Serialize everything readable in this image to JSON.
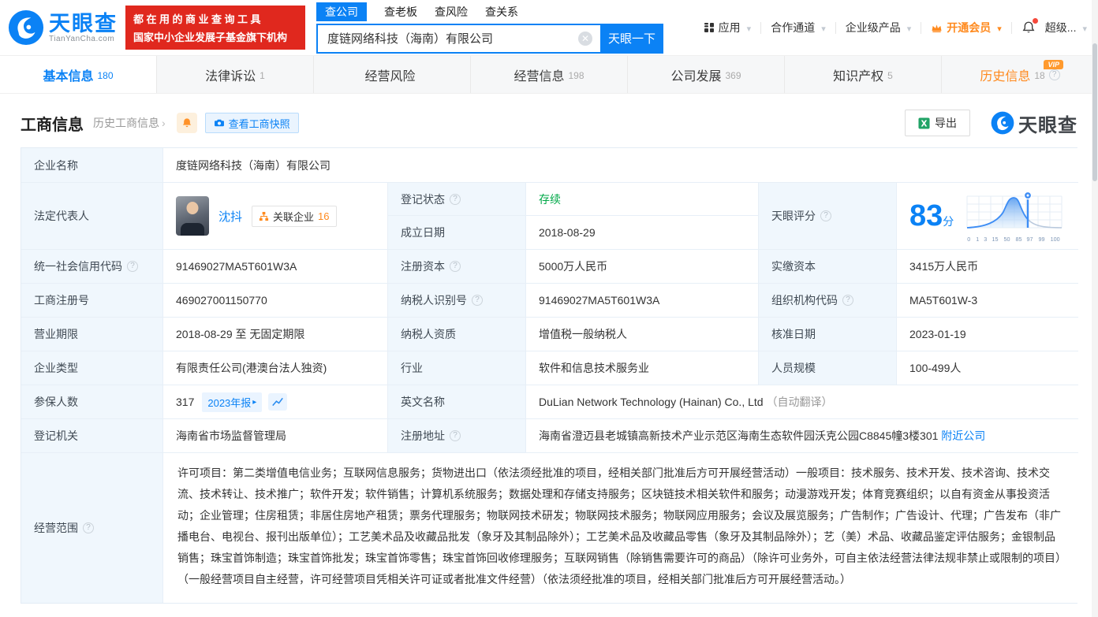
{
  "brand": {
    "logo_text": "天眼查",
    "domain": "TianYanCha.com",
    "slogan1": "都在用的商业查询工具",
    "slogan2": "国家中小企业发展子基金旗下机构"
  },
  "search": {
    "tabs": [
      "查公司",
      "查老板",
      "查风险",
      "查关系"
    ],
    "value": "度链网络科技（海南）有限公司",
    "button": "天眼一下"
  },
  "nav": {
    "app": "应用",
    "partner": "合作通道",
    "enterprise": "企业级产品",
    "vip": "开通会员",
    "super": "超级..."
  },
  "tabs": [
    {
      "label": "基本信息",
      "count": "180"
    },
    {
      "label": "法律诉讼",
      "count": "1"
    },
    {
      "label": "经营风险",
      "count": ""
    },
    {
      "label": "经营信息",
      "count": "198"
    },
    {
      "label": "公司发展",
      "count": "369"
    },
    {
      "label": "知识产权",
      "count": "5"
    },
    {
      "label": "历史信息",
      "count": "18",
      "vip_badge": "VIP"
    }
  ],
  "section": {
    "title": "工商信息",
    "history": "历史工商信息",
    "snapshot": "查看工商快照",
    "export": "导出",
    "brand": "天眼查"
  },
  "table": {
    "company_name_label": "企业名称",
    "company_name": "度链网络科技（海南）有限公司",
    "legal_rep_label": "法定代表人",
    "legal_rep_name": "沈抖",
    "related_company_label": "关联企业",
    "related_company_count": "16",
    "reg_status_label": "登记状态",
    "reg_status": "存续",
    "established_label": "成立日期",
    "established": "2018-08-29",
    "score_label": "天眼评分",
    "score_value": "83",
    "score_unit": "分",
    "score_ticks": [
      "0",
      "1",
      "3",
      "15",
      "50",
      "85",
      "97",
      "99",
      "100"
    ],
    "credit_code_label": "统一社会信用代码",
    "credit_code": "91469027MA5T601W3A",
    "reg_capital_label": "注册资本",
    "reg_capital": "5000万人民币",
    "paid_capital_label": "实缴资本",
    "paid_capital": "3415万人民币",
    "reg_no_label": "工商注册号",
    "reg_no": "469027001150770",
    "taxpayer_no_label": "纳税人识别号",
    "taxpayer_no": "91469027MA5T601W3A",
    "org_code_label": "组织机构代码",
    "org_code": "MA5T601W-3",
    "term_label": "营业期限",
    "term": "2018-08-29 至 无固定期限",
    "taxpayer_type_label": "纳税人资质",
    "taxpayer_type": "增值税一般纳税人",
    "approve_date_label": "核准日期",
    "approve_date": "2023-01-19",
    "type_label": "企业类型",
    "type": "有限责任公司(港澳台法人独资)",
    "industry_label": "行业",
    "industry": "软件和信息技术服务业",
    "staff_label": "人员规模",
    "staff": "100-499人",
    "insured_label": "参保人数",
    "insured": "317",
    "annual_report": "2023年报",
    "en_name_label": "英文名称",
    "en_name": "DuLian Network Technology (Hainan) Co., Ltd",
    "en_note": "（自动翻译）",
    "authority_label": "登记机关",
    "authority": "海南省市场监督管理局",
    "address_label": "注册地址",
    "address": "海南省澄迈县老城镇高新技术产业示范区海南生态软件园沃克公园C8845幢3楼301",
    "nearby": "附近公司",
    "scope_label": "经营范围",
    "scope": "许可项目：第二类增值电信业务；互联网信息服务；货物进出口（依法须经批准的项目，经相关部门批准后方可开展经营活动）一般项目：技术服务、技术开发、技术咨询、技术交流、技术转让、技术推广；软件开发；软件销售；计算机系统服务；数据处理和存储支持服务；区块链技术相关软件和服务；动漫游戏开发；体育竞赛组织；以自有资金从事投资活动；企业管理；住房租赁；非居住房地产租赁；票务代理服务；物联网技术研发；物联网技术服务；物联网应用服务；会议及展览服务；广告制作；广告设计、代理；广告发布（非广播电台、电视台、报刊出版单位）；工艺美术品及收藏品批发（象牙及其制品除外）；工艺美术品及收藏品零售（象牙及其制品除外）；艺（美）术品、收藏品鉴定评估服务；金银制品销售；珠宝首饰制造；珠宝首饰批发；珠宝首饰零售；珠宝首饰回收修理服务；互联网销售（除销售需要许可的商品）（除许可业务外，可自主依法经营法律法规非禁止或限制的项目）（一般经营项目自主经营，许可经营项目凭相关许可证或者批准文件经营）（依法须经批准的项目，经相关部门批准后方可开展经营活动。）"
  },
  "colors": {
    "accent": "#0b82f5",
    "green": "#00a848",
    "orange": "#ff8a1e",
    "banner_red": "#e0281e"
  }
}
